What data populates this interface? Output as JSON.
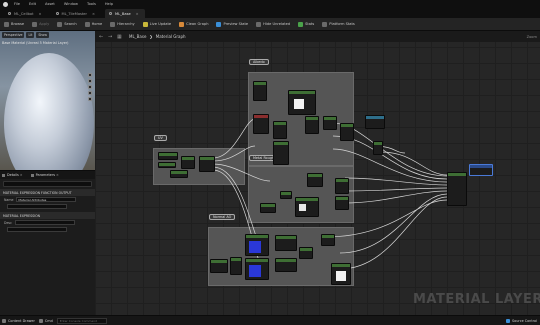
{
  "menu": [
    "File",
    "Edit",
    "Asset",
    "Window",
    "Tools",
    "Help"
  ],
  "tabs": [
    {
      "label": "ML_Cellbot",
      "active": false
    },
    {
      "label": "ML_TileMaster",
      "active": false
    },
    {
      "label": "ML_Base",
      "active": true
    }
  ],
  "toolbar": [
    {
      "label": "Browse",
      "icon": "folder-icon",
      "color": "gray",
      "dim": false
    },
    {
      "label": "Apply",
      "icon": "apply-icon",
      "color": "gray",
      "dim": true
    },
    {
      "label": "Search",
      "icon": "search-icon",
      "color": "gray",
      "dim": false
    },
    {
      "label": "Home",
      "icon": "home-icon",
      "color": "gray",
      "dim": false
    },
    {
      "label": "Hierarchy",
      "icon": "hierarchy-icon",
      "color": "gray",
      "dim": false
    },
    {
      "label": "Live Update",
      "icon": "live-update-icon",
      "color": "yellow",
      "dim": false
    },
    {
      "label": "Clean Graph",
      "icon": "clean-graph-icon",
      "color": "orange",
      "dim": false
    },
    {
      "label": "Preview State",
      "icon": "preview-state-icon",
      "color": "blue",
      "dim": false
    },
    {
      "label": "Hide Unrelated",
      "icon": "hide-unrelated-icon",
      "color": "gray",
      "dim": false
    },
    {
      "label": "Stats",
      "icon": "stats-icon",
      "color": "green",
      "dim": false
    },
    {
      "label": "Platform Stats",
      "icon": "platform-stats-icon",
      "color": "gray",
      "dim": false
    }
  ],
  "viewport": {
    "buttons": [
      "Perspective",
      "Lit",
      "Show"
    ],
    "caption": "Base Material (Unreal 5 Material Layer)"
  },
  "details": {
    "tabs": [
      "Details",
      "Parameters"
    ],
    "section1": "MATERIAL EXPRESSION FUNCTION OUTPUT",
    "rows1": [
      {
        "label": "Name",
        "value": "Material Attributes"
      },
      {
        "label": "",
        "value": ""
      }
    ],
    "section2": "MATERIAL EXPRESSION",
    "rows2": [
      {
        "label": "Desc",
        "value": ""
      },
      {
        "label": "",
        "value": ""
      }
    ]
  },
  "graph": {
    "breadcrumb": "ML_Base",
    "breadcrumb_sub": "Material Graph",
    "zoom": "Zoom",
    "comments": [
      "UV",
      "Albedo",
      "Metal Roughness",
      "Normal AO"
    ],
    "watermark": "MATERIAL LAYER"
  },
  "statusbar": {
    "content_drawer": "Content Drawer",
    "cmd": "Cmd",
    "console_placeholder": "Enter Console Command",
    "source_control": "Source Control"
  }
}
